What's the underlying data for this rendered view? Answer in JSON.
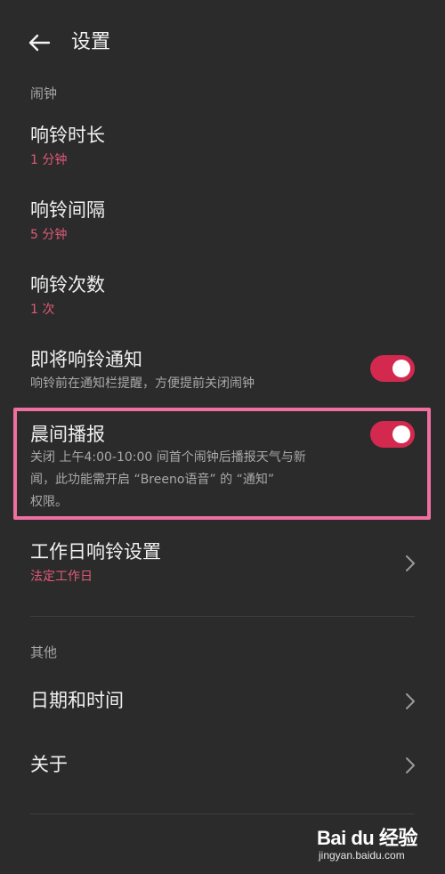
{
  "header": {
    "title": "设置"
  },
  "sections": {
    "alarm_label": "闹钟",
    "other_label": "其他"
  },
  "items": {
    "ring_duration": {
      "title": "响铃时长",
      "value": "1 分钟"
    },
    "ring_interval": {
      "title": "响铃间隔",
      "value": "5 分钟"
    },
    "ring_count": {
      "title": "响铃次数",
      "value": "1 次"
    },
    "upcoming_notice": {
      "title": "即将响铃通知",
      "desc": "响铃前在通知栏提醒，方便提前关闭闹钟",
      "enabled": true
    },
    "morning_report": {
      "title": "晨间播报",
      "desc_line1": "关闭 上午4:00-10:00 间首个闹钟后播报天气与新",
      "desc_line2": "闻，此功能需开启 “Breeno语音” 的 “通知”",
      "desc_line3": "权限。",
      "enabled": true
    },
    "workday": {
      "title": "工作日响铃设置",
      "value": "法定工作日"
    },
    "date_time": {
      "title": "日期和时间"
    },
    "about": {
      "title": "关于"
    }
  },
  "colors": {
    "accent": "#d4294f",
    "value_text": "#e05a78",
    "highlight_border": "#ef6fa1",
    "background": "#2b2b2b"
  },
  "watermark": {
    "brand": "Bai du 经验",
    "url": "jingyan.baidu.com"
  }
}
